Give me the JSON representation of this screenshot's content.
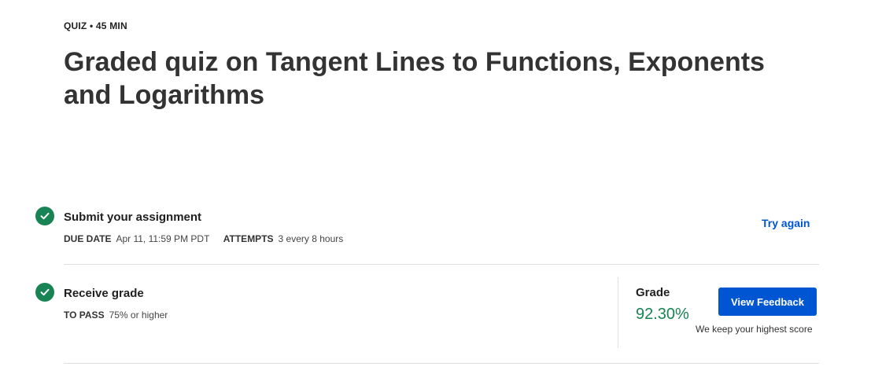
{
  "header": {
    "eyebrow": "QUIZ • 45 MIN",
    "title": "Graded quiz on Tangent Lines to Functions, Exponents and Logarithms"
  },
  "submit_step": {
    "title": "Submit your assignment",
    "due_date_label": "DUE DATE",
    "due_date_value": "Apr 11, 11:59 PM PDT",
    "attempts_label": "ATTEMPTS",
    "attempts_value": "3 every 8 hours",
    "try_again_label": "Try again"
  },
  "grade_step": {
    "title": "Receive grade",
    "to_pass_label": "TO PASS",
    "to_pass_value": "75% or higher",
    "grade_label": "Grade",
    "grade_value": "92.30%",
    "view_feedback_label": "View Feedback",
    "note": "We keep your highest score"
  },
  "colors": {
    "accent": "#0056d2",
    "success": "#188353"
  },
  "icons": {
    "step_complete": "check-circle-icon"
  }
}
